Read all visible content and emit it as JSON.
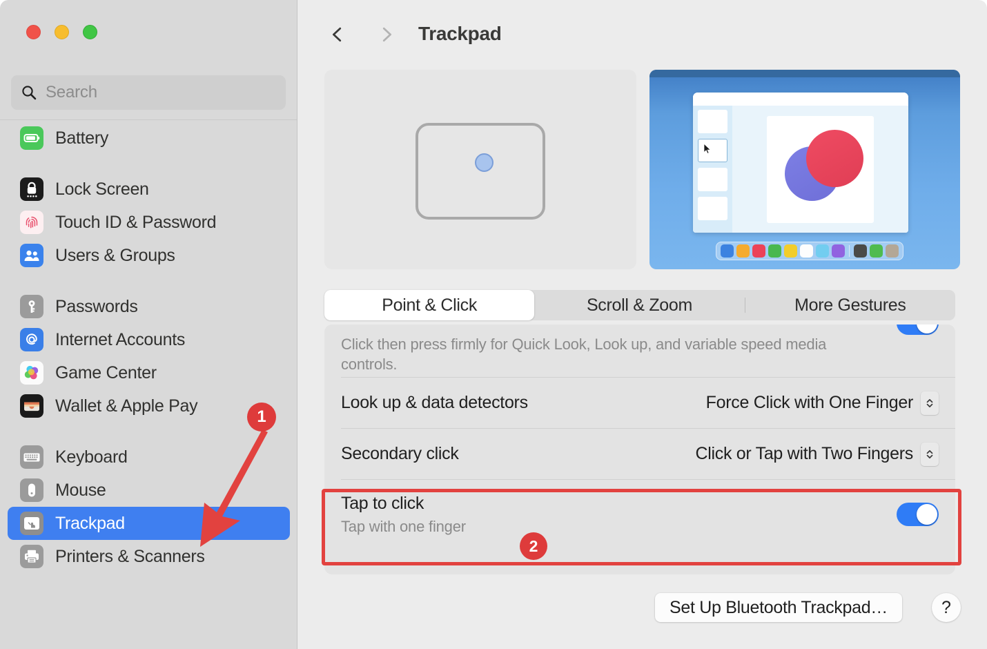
{
  "window": {
    "traffic_lights": [
      "close",
      "minimize",
      "zoom"
    ]
  },
  "search": {
    "placeholder": "Search",
    "value": "",
    "icon": "search-icon"
  },
  "sidebar": {
    "groups": [
      {
        "items": [
          {
            "label": "Battery",
            "icon": "battery-icon",
            "selected": false
          }
        ]
      },
      {
        "items": [
          {
            "label": "Lock Screen",
            "icon": "lock-screen-icon",
            "selected": false
          },
          {
            "label": "Touch ID & Password",
            "icon": "touch-id-icon",
            "selected": false
          },
          {
            "label": "Users & Groups",
            "icon": "users-groups-icon",
            "selected": false
          }
        ]
      },
      {
        "items": [
          {
            "label": "Passwords",
            "icon": "passwords-key-icon",
            "selected": false
          },
          {
            "label": "Internet Accounts",
            "icon": "internet-accounts-icon",
            "selected": false
          },
          {
            "label": "Game Center",
            "icon": "game-center-icon",
            "selected": false
          },
          {
            "label": "Wallet & Apple Pay",
            "icon": "wallet-icon",
            "selected": false
          }
        ]
      },
      {
        "items": [
          {
            "label": "Keyboard",
            "icon": "keyboard-icon",
            "selected": false
          },
          {
            "label": "Mouse",
            "icon": "mouse-icon",
            "selected": false
          },
          {
            "label": "Trackpad",
            "icon": "trackpad-icon",
            "selected": true
          },
          {
            "label": "Printers & Scanners",
            "icon": "printer-icon",
            "selected": false
          }
        ]
      }
    ]
  },
  "header": {
    "title": "Trackpad",
    "back_icon": "chevron-left-icon",
    "forward_icon": "chevron-right-icon",
    "back_enabled": true,
    "forward_enabled": false
  },
  "preview": {
    "trackpad_illustration": "trackpad-outline-with-touch-dot",
    "desktop_preview": "desktop-window-with-circles-and-color-dock",
    "dock_swatches": [
      "#3c82e0",
      "#f5ab2e",
      "#ec4257",
      "#49b84e",
      "#f2cd2a",
      "#fdfdfd",
      "#72cdf0",
      "#9163e0",
      "#4a4a48",
      "#4fbb4f",
      "#b3a796"
    ]
  },
  "tabs": [
    {
      "label": "Point & Click",
      "active": true
    },
    {
      "label": "Scroll & Zoom",
      "active": false
    },
    {
      "label": "More Gestures",
      "active": false
    }
  ],
  "settings_rows": [
    {
      "type": "description",
      "description": "Click then press firmly for Quick Look, Look up, and variable speed media controls.",
      "toggle_on": true
    },
    {
      "type": "popup",
      "label": "Look up & data detectors",
      "value": "Force Click with One Finger"
    },
    {
      "type": "popup",
      "label": "Secondary click",
      "value": "Click or Tap with Two Fingers"
    },
    {
      "type": "toggle",
      "label": "Tap to click",
      "sublabel": "Tap with one finger",
      "toggle_on": true
    }
  ],
  "footer": {
    "setup_button": "Set Up Bluetooth Trackpad…",
    "help_button": "?"
  },
  "annotations": {
    "badge_1": "1",
    "badge_2": "2",
    "arrow_color": "#e2423f",
    "box_color": "#e2423f"
  }
}
